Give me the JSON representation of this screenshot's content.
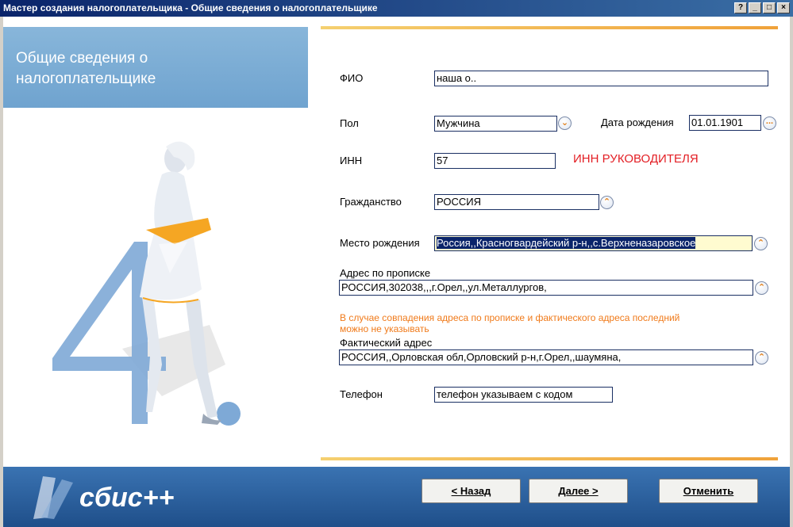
{
  "window": {
    "title": "Мастер создания налогоплательщика - Общие сведения о налогоплательщике",
    "help_btn": "?",
    "min_btn": "_",
    "max_btn": "□",
    "close_btn": "×"
  },
  "header": {
    "title": "Общие сведения о налогоплательщике"
  },
  "illustration": {
    "step_number": "4."
  },
  "form": {
    "fio": {
      "label": "ФИО",
      "value": "наша о.."
    },
    "gender": {
      "label": "Пол",
      "value": "Мужчина"
    },
    "birth_date": {
      "label": "Дата рождения",
      "value": "01.01.1901",
      "btn": "..."
    },
    "inn": {
      "label": "ИНН",
      "value": "57",
      "note": "ИНН РУКОВОДИТЕЛЯ"
    },
    "citizenship": {
      "label": "Гражданство",
      "value": "РОССИЯ"
    },
    "birth_place": {
      "label": "Место рождения",
      "value": "Россия,,Красногвардейский р-н,,с.Верхненазаровское"
    },
    "reg_address": {
      "label": "Адрес по прописке",
      "value": "РОССИЯ,302038,,,г.Орел,,ул.Металлургов,"
    },
    "address_note": "В случае совпадения адреса по прописке и фактического адреса последний можно не указывать",
    "actual_address": {
      "label": "Фактический адрес",
      "value": "РОССИЯ,,Орловская обл,Орловский р-н,г.Орел,,шаумяна,"
    },
    "phone": {
      "label": "Телефон",
      "value": "телефон указываем с кодом"
    }
  },
  "footer": {
    "logo_text": "сбис++",
    "back_label": "< Назад",
    "next_label": "Далее >",
    "cancel_label": "Отменить"
  },
  "colors": {
    "accent_orange": "#f0a23a",
    "panel_blue": "#7aaed6",
    "footer_blue": "#2a5f9e",
    "alert_red": "#e31e24",
    "note_orange": "#f07a1a"
  }
}
